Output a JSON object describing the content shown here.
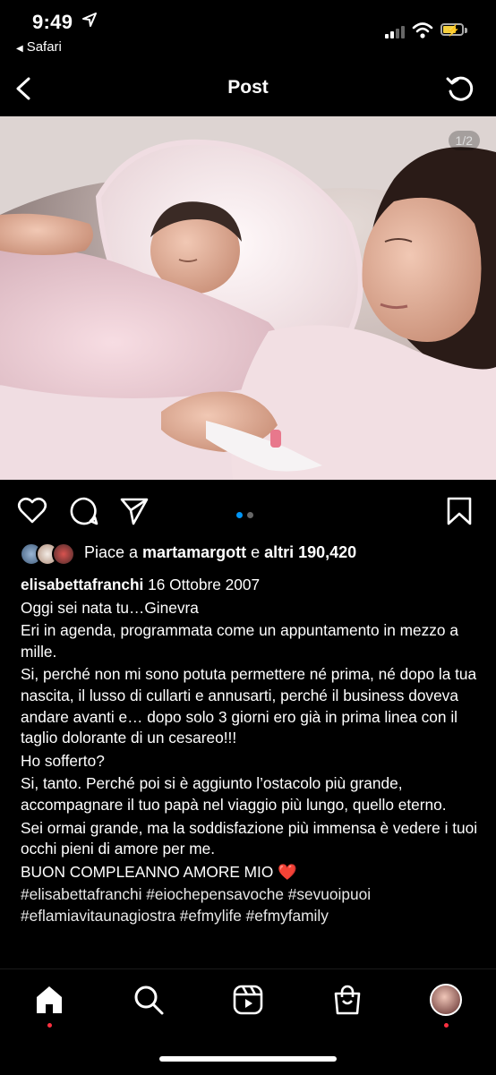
{
  "status_bar": {
    "time": "9:49",
    "back_app": "Safari",
    "battery_color": "#f4d03f"
  },
  "header": {
    "title": "Post",
    "back_icon": "chevron-left-icon",
    "refresh_icon": "refresh-icon"
  },
  "post": {
    "image_counter": "1/2",
    "image_description_icon": "photo",
    "carousel_active_color": "#0095f6",
    "likes": {
      "prefix": "Piace a ",
      "user": "martamargott",
      "middle": " e ",
      "count": "altri 190,420"
    },
    "caption": {
      "username": "elisabettafranchi",
      "date": "16 Ottobre 2007",
      "lines": [
        "Oggi sei nata tu…Ginevra",
        "Eri in agenda, programmata come un appuntamento in mezzo a mille.",
        "Si, perché non mi sono potuta permettere né prima, né dopo la tua nascita, il lusso di cullarti e annusarti, perché il business doveva andare avanti e… dopo solo 3 giorni ero già in prima linea con il taglio dolorante di un cesareo!!!",
        "Ho sofferto?",
        "Si, tanto. Perché poi si è aggiunto l’ostacolo più grande, accompagnare il tuo papà nel viaggio più lungo, quello eterno.",
        "Sei ormai grande, ma la soddisfazione più immensa è vedere i tuoi occhi pieni di amore per me.",
        "BUON COMPLEANNO AMORE MIO ❤️"
      ],
      "hashtags": "#elisabettafranchi #eiochepensavoche #sevuoipuoi #eflamiavitaunagiostra #efmylife #efmyfamily"
    }
  },
  "tab_bar": {
    "items": [
      "home-icon",
      "search-icon",
      "reels-icon",
      "shop-icon",
      "profile-avatar"
    ],
    "notification_color": "#ff3040"
  }
}
